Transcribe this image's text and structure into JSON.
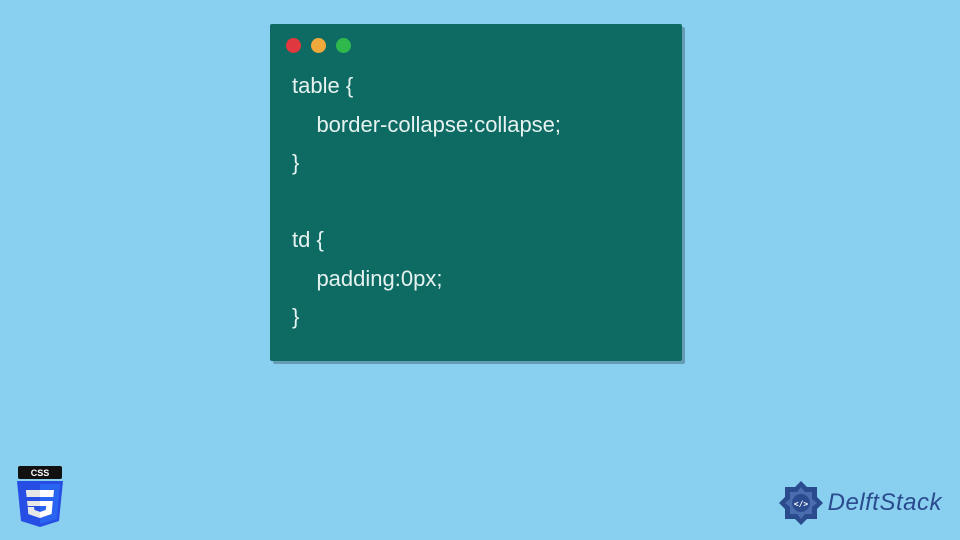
{
  "code": {
    "line1": "table {",
    "line2": "    border-collapse:collapse;",
    "line3": "}",
    "line4": "",
    "line5": "td {",
    "line6": "    padding:0px;",
    "line7": "}"
  },
  "badges": {
    "css_label": "CSS",
    "brand_name": "DelftStack"
  }
}
